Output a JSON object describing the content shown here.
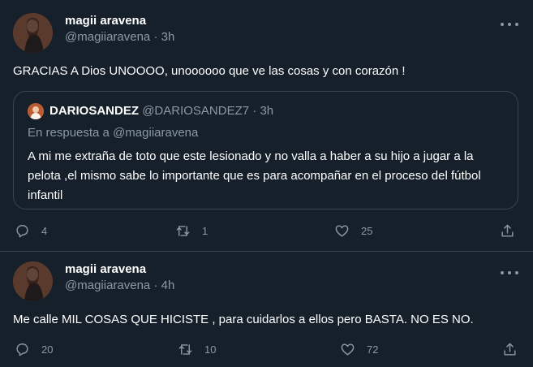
{
  "tweets": [
    {
      "name": "magii aravena",
      "handle": "@magiiaravena",
      "separator": "·",
      "time": "3h",
      "text": "GRACIAS A Dios UNOOOO, unoooooo que ve las cosas y con corazón !",
      "quote": {
        "name": "DARIOSANDEZ",
        "handle": "@DARIOSANDEZ7",
        "separator": "·",
        "time": "3h",
        "reply_prefix": "En respuesta a",
        "reply_mention": "@magiiaravena",
        "text": "A mi me extraña de toto que este lesionado y no valla a haber a su hijo a jugar a la pelota ,el mismo sabe lo importante que es para acompañar en el proceso del fútbol infantil"
      },
      "replies": "4",
      "retweets": "1",
      "likes": "25"
    },
    {
      "name": "magii aravena",
      "handle": "@magiiaravena",
      "separator": "·",
      "time": "4h",
      "text": "Me calle MIL COSAS QUE HICISTE , para cuidarlos a ellos pero BASTA. NO ES NO.",
      "replies": "20",
      "retweets": "10",
      "likes": "72"
    }
  ],
  "icons": {
    "reply": "reply-icon",
    "retweet": "retweet-icon",
    "like": "like-icon",
    "share": "share-icon",
    "more": "more-icon"
  },
  "colors": {
    "background": "#15202b",
    "border": "#38444d",
    "secondary_text": "#8b98a5",
    "primary_text": "#ffffff"
  }
}
